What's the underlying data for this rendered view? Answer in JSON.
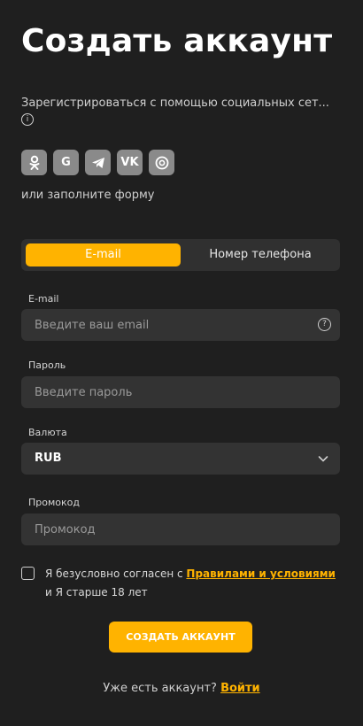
{
  "header": {
    "title": "Создать аккаунт"
  },
  "social": {
    "text": "Зарегистрироваться с помощью социальных сет...",
    "info_icon": "info-icon",
    "items": [
      {
        "icon": "odnoklassniki-icon"
      },
      {
        "icon": "google-icon",
        "label": "G"
      },
      {
        "icon": "telegram-icon"
      },
      {
        "icon": "vk-icon",
        "label": "VK"
      },
      {
        "icon": "mail-at-icon"
      }
    ]
  },
  "or_text": "или заполните форму",
  "tabs": [
    {
      "label": "E-mail",
      "active": true
    },
    {
      "label": "Номер телефона",
      "active": false
    }
  ],
  "form": {
    "email": {
      "label": "E-mail",
      "placeholder": "Введите ваш email"
    },
    "password": {
      "label": "Пароль",
      "placeholder": "Введите пароль"
    },
    "currency": {
      "label": "Валюта",
      "value": "RUB"
    },
    "promo": {
      "label": "Промокод",
      "placeholder": "Промокод"
    }
  },
  "agreement": {
    "prefix": "Я безусловно согласен с ",
    "link": "Правилами и условиями",
    "suffix": " и Я старше 18 лет"
  },
  "submit_label": "СОЗДАТЬ АККАУНТ",
  "login": {
    "prompt": "Уже есть аккаунт?",
    "link": "Войти"
  },
  "colors": {
    "accent": "#ffb300",
    "background": "#1f1f1f",
    "field": "#333333",
    "social_bg": "#8a8a8a"
  }
}
